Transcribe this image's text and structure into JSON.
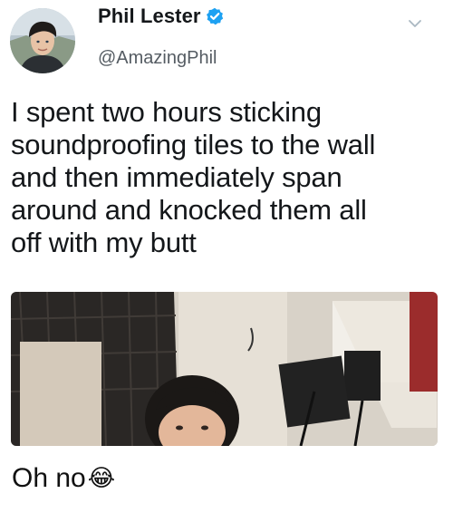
{
  "tweet": {
    "author": {
      "display_name": "Phil Lester",
      "handle": "@AmazingPhil",
      "verified": true,
      "avatar_icon": "avatar-photo"
    },
    "menu_icon": "chevron-down-icon",
    "text": "I spent two hours sticking\nsoundproofing tiles to the wall\nand then immediately span\naround and knocked them all\noff with my butt",
    "media": {
      "description_icon": "photo-image"
    }
  },
  "caption": {
    "text": "Oh no",
    "emoji": "😂"
  },
  "colors": {
    "text": "#14171a",
    "handle": "#555c63",
    "verified": "#1da1f2",
    "chevron": "#aab8c2"
  }
}
